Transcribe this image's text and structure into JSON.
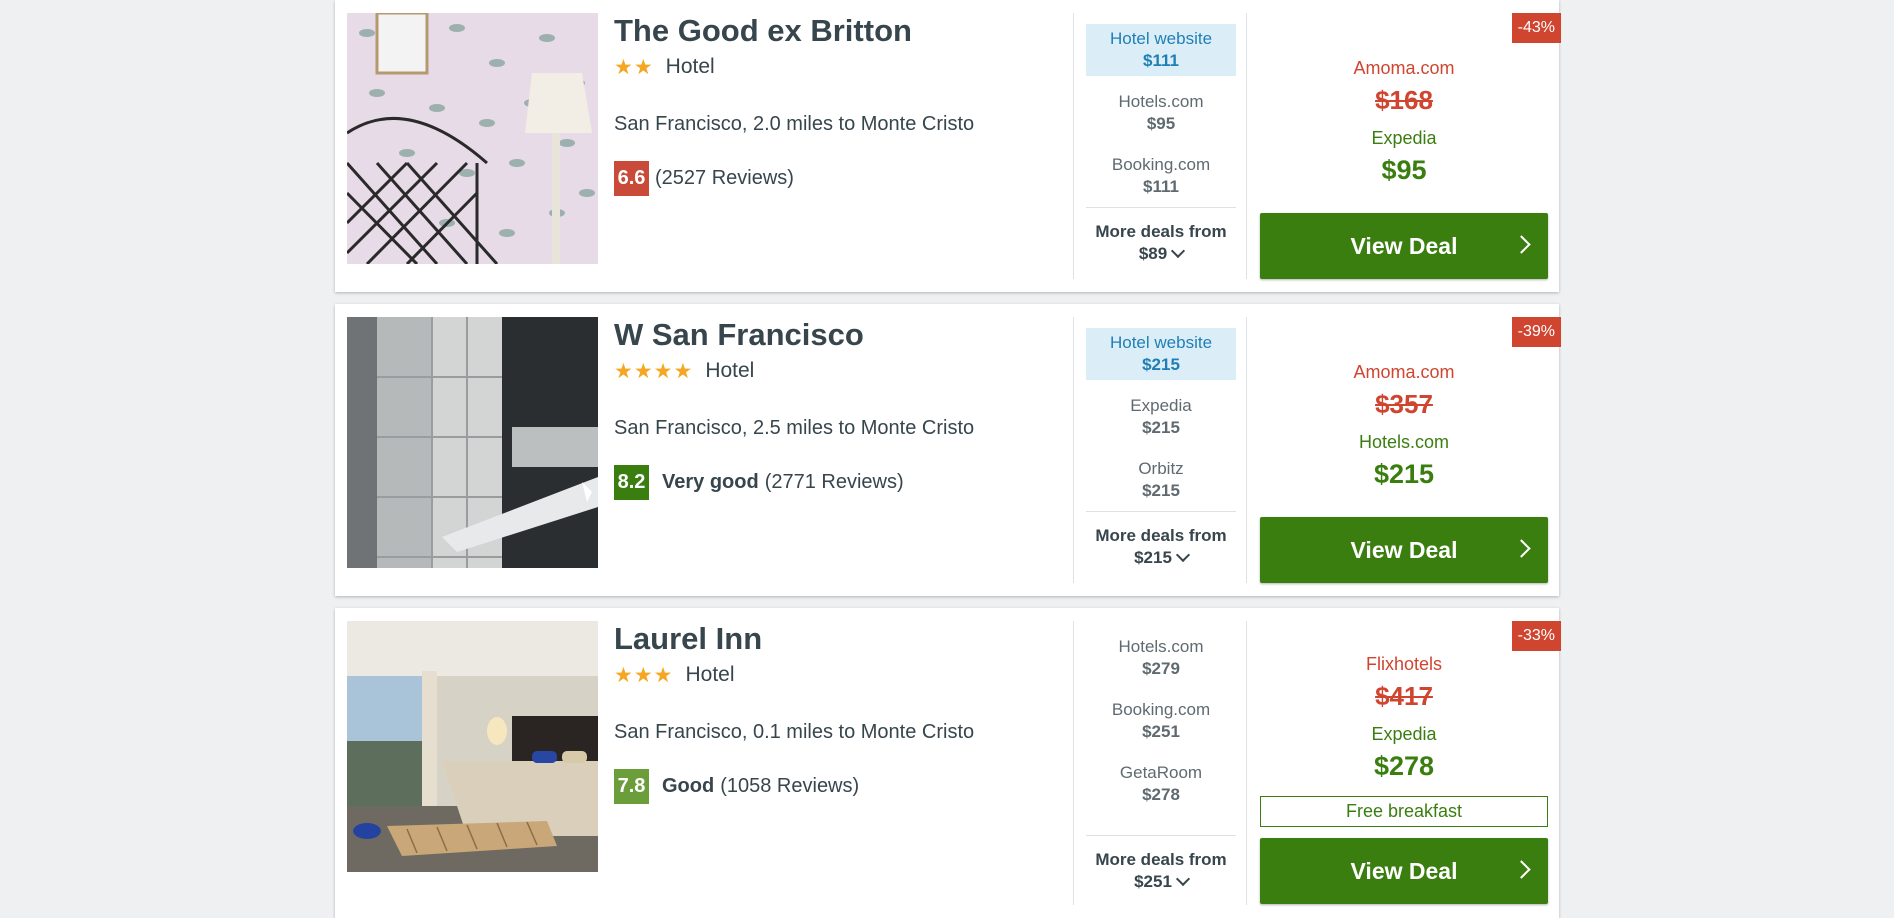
{
  "hotels": [
    {
      "name": "The Good ex Britton",
      "stars": "★★",
      "type": "Hotel",
      "location": "San Francisco, 2.0 miles to Monte Cristo",
      "score": "6.6",
      "rating_label": "",
      "reviews": "(2527 Reviews)",
      "providers": [
        {
          "site": "Hotel website",
          "price": "$111"
        },
        {
          "site": "Hotels.com",
          "price": "$95"
        },
        {
          "site": "Booking.com",
          "price": "$111"
        }
      ],
      "more_label": "More deals from",
      "more_price": "$89",
      "discount": "-43%",
      "orig_site": "Amoma.com",
      "orig_price": "$168",
      "deal_site": "Expedia",
      "deal_price": "$95",
      "button": "View Deal"
    },
    {
      "name": "W San Francisco",
      "stars": "★★★★",
      "type": "Hotel",
      "location": "San Francisco, 2.5 miles to Monte Cristo",
      "score": "8.2",
      "rating_label": "Very good",
      "reviews": "(2771 Reviews)",
      "providers": [
        {
          "site": "Hotel website",
          "price": "$215"
        },
        {
          "site": "Expedia",
          "price": "$215"
        },
        {
          "site": "Orbitz",
          "price": "$215"
        }
      ],
      "more_label": "More deals from",
      "more_price": "$215",
      "discount": "-39%",
      "orig_site": "Amoma.com",
      "orig_price": "$357",
      "deal_site": "Hotels.com",
      "deal_price": "$215",
      "button": "View Deal"
    },
    {
      "name": "Laurel Inn",
      "stars": "★★★",
      "type": "Hotel",
      "location": "San Francisco, 0.1 miles to Monte Cristo",
      "score": "7.8",
      "rating_label": "Good",
      "reviews": "(1058 Reviews)",
      "providers": [
        {
          "site": "Hotels.com",
          "price": "$279"
        },
        {
          "site": "Booking.com",
          "price": "$251"
        },
        {
          "site": "GetaRoom",
          "price": "$278"
        }
      ],
      "more_label": "More deals from",
      "more_price": "$251",
      "discount": "-33%",
      "orig_site": "Flixhotels",
      "orig_price": "$417",
      "deal_site": "Expedia",
      "deal_price": "$278",
      "perk": "Free breakfast",
      "button": "View Deal"
    }
  ],
  "colors": {
    "deal_green": "#3b7e10",
    "discount_red": "#cf4530",
    "star": "#f5a623",
    "highlight_blue": "#1f7fb4"
  }
}
